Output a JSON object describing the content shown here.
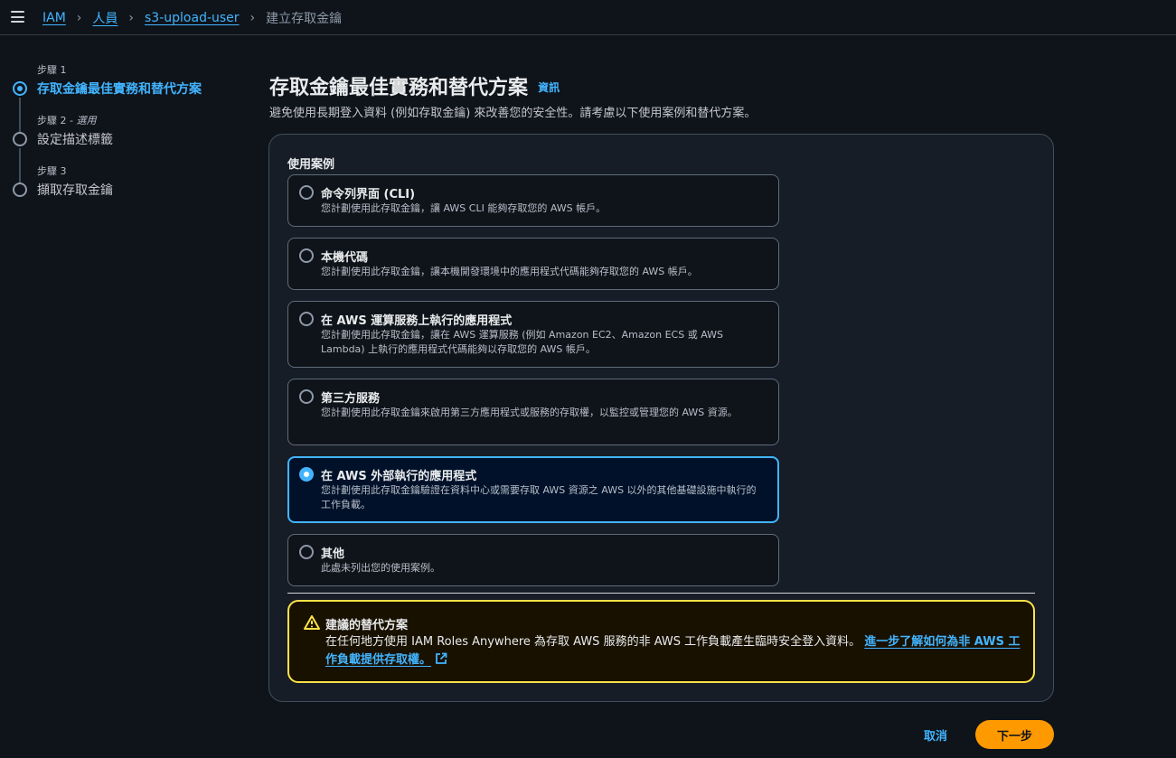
{
  "breadcrumb": {
    "items": [
      "IAM",
      "人員",
      "s3-upload-user"
    ],
    "current": "建立存取金鑰",
    "separator": "›"
  },
  "steps": [
    {
      "kicker": "步驟 1",
      "kicker_optional": "",
      "title": "存取金鑰最佳實務和替代方案",
      "active": true
    },
    {
      "kicker": "步驟 2 - ",
      "kicker_optional": "選用",
      "title": "設定描述標籤",
      "active": false
    },
    {
      "kicker": "步驟 3",
      "kicker_optional": "",
      "title": "擷取存取金鑰",
      "active": false
    }
  ],
  "header": {
    "title": "存取金鑰最佳實務和替代方案",
    "info": "資訊",
    "description": "避免使用長期登入資料 (例如存取金鑰) 來改善您的安全性。請考慮以下使用案例和替代方案。"
  },
  "use_case": {
    "label": "使用案例",
    "options": [
      {
        "title": "命令列界面 (CLI)",
        "desc": "您計劃使用此存取金鑰，讓 AWS CLI 能夠存取您的 AWS 帳戶。",
        "selected": false
      },
      {
        "title": "本機代碼",
        "desc": "您計劃使用此存取金鑰，讓本機開發環境中的應用程式代碼能夠存取您的 AWS 帳戶。",
        "selected": false
      },
      {
        "title": "在 AWS 運算服務上執行的應用程式",
        "desc": "您計劃使用此存取金鑰，讓在 AWS 運算服務 (例如 Amazon EC2、Amazon ECS 或 AWS Lambda) 上執行的應用程式代碼能夠以存取您的 AWS 帳戶。",
        "selected": false
      },
      {
        "title": "第三方服務",
        "desc": "您計劃使用此存取金鑰來啟用第三方應用程式或服務的存取權，以監控或管理您的 AWS 資源。",
        "selected": false
      },
      {
        "title": "在 AWS 外部執行的應用程式",
        "desc": "您計劃使用此存取金鑰驗證在資料中心或需要存取 AWS 資源之 AWS 以外的其他基礎設施中執行的工作負載。",
        "selected": true
      },
      {
        "title": "其他",
        "desc": "此處未列出您的使用案例。",
        "selected": false
      }
    ]
  },
  "alert": {
    "title": "建議的替代方案",
    "body": "在任何地方使用 IAM Roles Anywhere 為存取 AWS 服務的非 AWS 工作負載產生臨時安全登入資料。",
    "link": "進一步了解如何為非 AWS 工作負載提供存取權。"
  },
  "footer": {
    "cancel": "取消",
    "next": "下一步"
  },
  "colors": {
    "accent": "#42b4ff",
    "primary_button": "#ff9900",
    "warning": "#ffe347"
  }
}
